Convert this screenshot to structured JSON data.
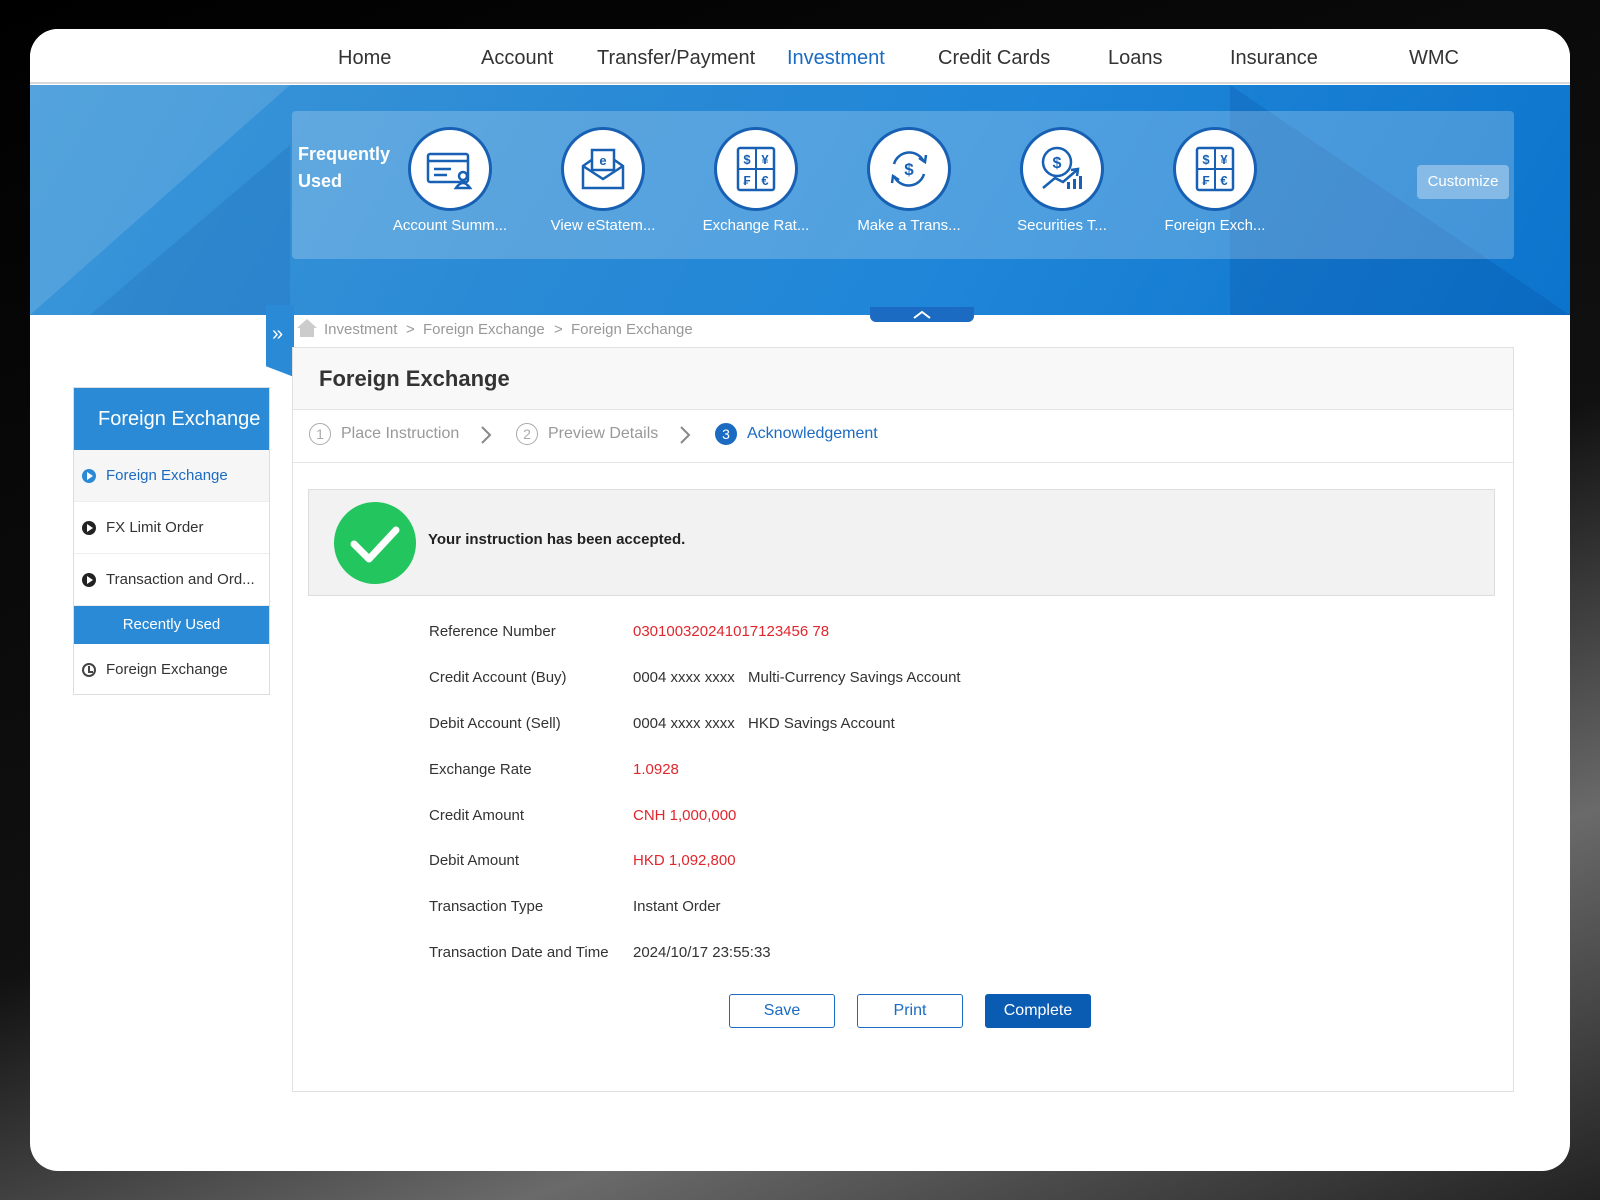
{
  "nav": {
    "items": [
      {
        "label": "Home",
        "active": false
      },
      {
        "label": "Account",
        "active": false
      },
      {
        "label": "Transfer/Payment",
        "active": false
      },
      {
        "label": "Investment",
        "active": true
      },
      {
        "label": "Credit Cards",
        "active": false
      },
      {
        "label": "Loans",
        "active": false
      },
      {
        "label": "Insurance",
        "active": false
      },
      {
        "label": "WMC",
        "active": false
      }
    ]
  },
  "frequently_used": {
    "title_line1": "Frequently",
    "title_line2": "Used",
    "items": [
      {
        "label": "Account Summ...",
        "icon": "account-summary-icon"
      },
      {
        "label": "View eStatem...",
        "icon": "estatement-icon"
      },
      {
        "label": "Exchange Rat...",
        "icon": "exchange-rate-icon"
      },
      {
        "label": "Make a Trans...",
        "icon": "transfer-icon"
      },
      {
        "label": "Securities T...",
        "icon": "securities-icon"
      },
      {
        "label": "Foreign Exch...",
        "icon": "foreign-exchange-icon"
      }
    ],
    "customize_label": "Customize"
  },
  "sidebar": {
    "title": "Foreign Exchange",
    "items": [
      {
        "label": "Foreign Exchange",
        "active": true
      },
      {
        "label": "FX Limit Order",
        "active": false
      },
      {
        "label": "Transaction and Ord...",
        "active": false
      }
    ],
    "recent_title": "Recently Used",
    "recent_items": [
      {
        "label": "Foreign Exchange"
      }
    ]
  },
  "breadcrumb": {
    "items": [
      "Investment",
      "Foreign Exchange",
      "Foreign Exchange"
    ],
    "separator": ">"
  },
  "main": {
    "title": "Foreign Exchange",
    "steps": [
      {
        "num": "1",
        "label": "Place Instruction",
        "active": false
      },
      {
        "num": "2",
        "label": "Preview Details",
        "active": false
      },
      {
        "num": "3",
        "label": "Acknowledgement",
        "active": true
      }
    ],
    "success_message": "Your instruction has been accepted.",
    "details": {
      "reference": {
        "label": "Reference Number",
        "value": "030100320241017123456 78"
      },
      "credit_account": {
        "label": "Credit Account (Buy)",
        "number": "0004 xxxx xxxx",
        "name": "Multi-Currency Savings Account"
      },
      "debit_account": {
        "label": "Debit Account (Sell)",
        "number": "0004 xxxx xxxx",
        "name": "HKD Savings Account"
      },
      "exchange_rate": {
        "label": "Exchange Rate",
        "value": "1.0928"
      },
      "credit_amount": {
        "label": "Credit Amount",
        "value": "CNH 1,000,000"
      },
      "debit_amount": {
        "label": "Debit Amount",
        "value": "HKD 1,092,800"
      },
      "transaction_type": {
        "label": "Transaction Type",
        "value": "Instant Order"
      },
      "transaction_datetime": {
        "label": "Transaction Date and Time",
        "value": "2024/10/17 23:55:33"
      }
    },
    "buttons": {
      "save": "Save",
      "print": "Print",
      "complete": "Complete"
    }
  },
  "colors": {
    "accent": "#1a6bc1",
    "banner": "#2a8ad5",
    "highlight_red": "#e0262d",
    "success_green": "#22c55e"
  }
}
